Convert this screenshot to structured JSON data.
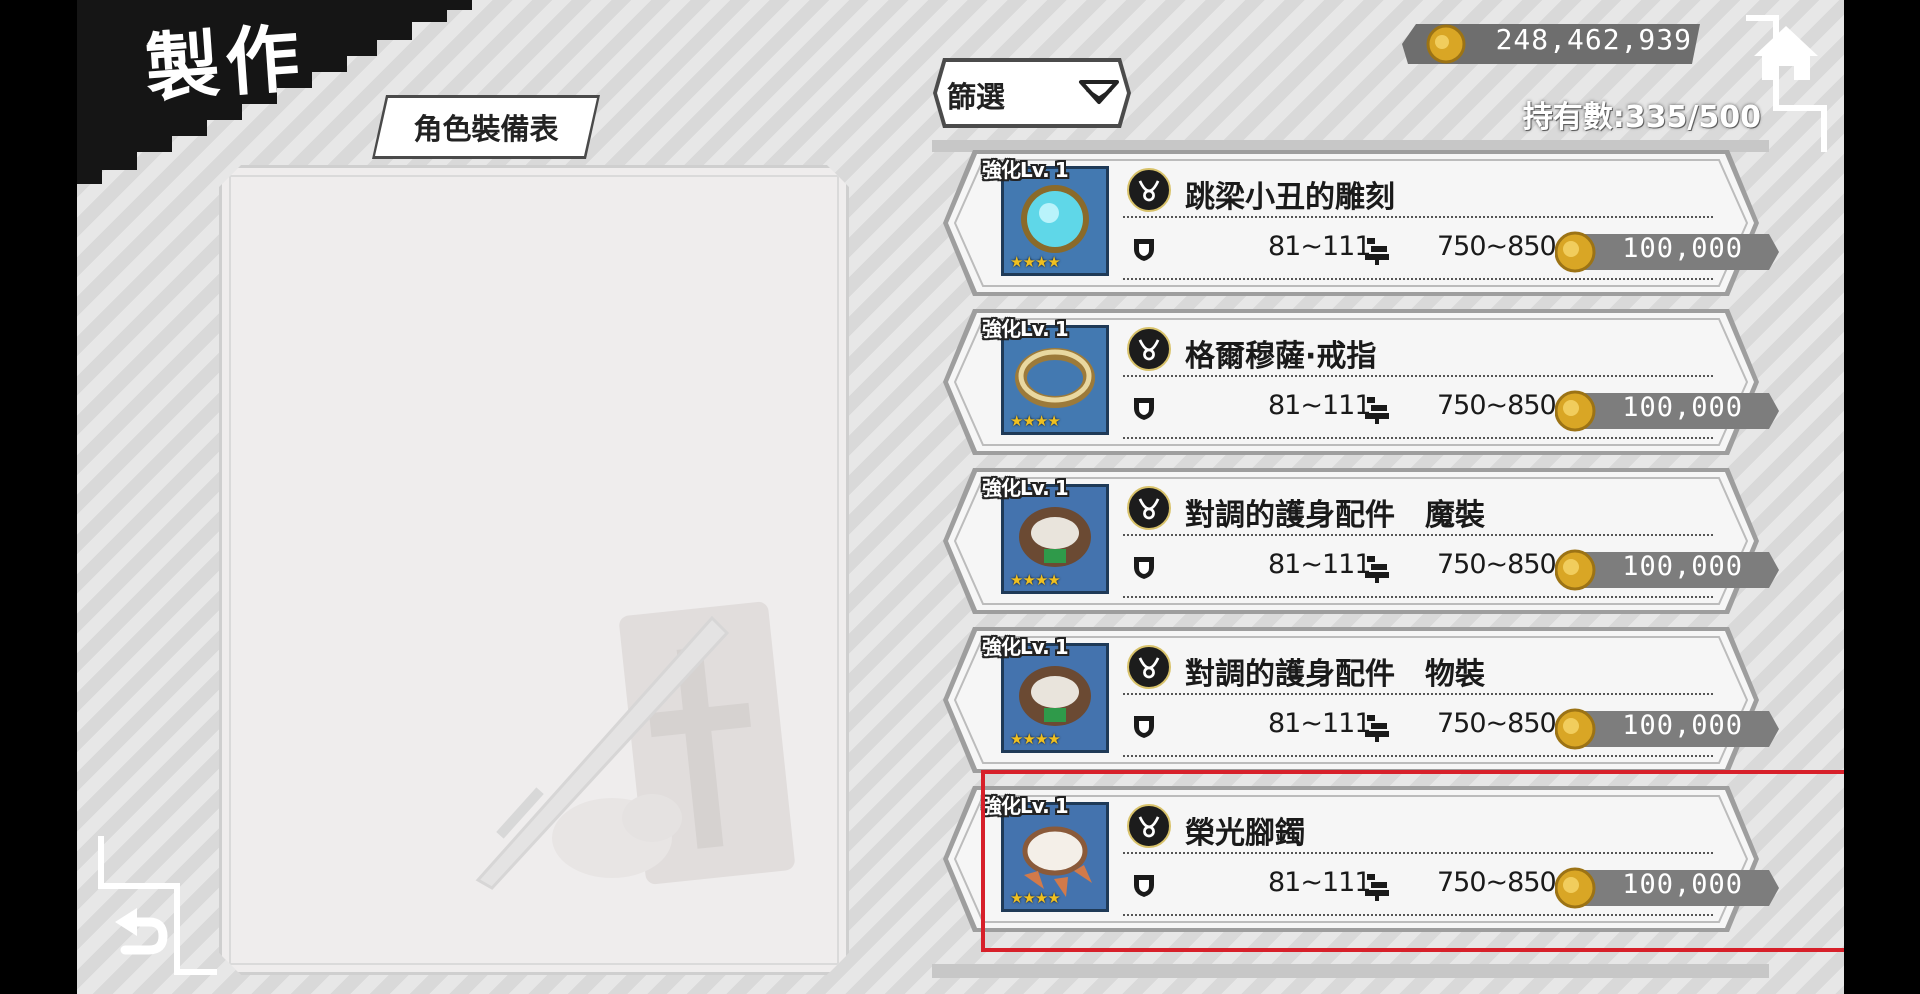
{
  "header": {
    "title": "製作",
    "equipment_tab_label": "角色裝備表",
    "filter_label": "篩選",
    "currency_amount": "248,462,939",
    "held_count_label": "持有數",
    "held_count_value": ":335/500"
  },
  "icons": {
    "home": "home-icon",
    "back": "return-arrow-icon",
    "coin": "gold-coin-icon",
    "filter_dropdown": "chevron-down-icon",
    "accessory_type": "necklace-icon",
    "defense": "shield-icon",
    "weight": "weight-icon"
  },
  "items": [
    {
      "level": "強化Lv. 1",
      "stars": "★★★★",
      "name": "跳梁小丑的雕刻",
      "defense": "81~111",
      "weight": "750~850",
      "price": "100,000",
      "thumb": "blue-gem-brooch"
    },
    {
      "level": "強化Lv. 1",
      "stars": "★★★★",
      "name": "格爾穆薩·戒指",
      "defense": "81~111",
      "weight": "750~850",
      "price": "100,000",
      "thumb": "gold-ring"
    },
    {
      "level": "強化Lv. 1",
      "stars": "★★★★",
      "name": "對調的護身配件　魔裝",
      "defense": "81~111",
      "weight": "750~850",
      "price": "100,000",
      "thumb": "leather-bracelet"
    },
    {
      "level": "強化Lv. 1",
      "stars": "★★★★",
      "name": "對調的護身配件　物裝",
      "defense": "81~111",
      "weight": "750~850",
      "price": "100,000",
      "thumb": "leather-bracelet"
    },
    {
      "level": "強化Lv. 1",
      "stars": "★★★★",
      "name": "榮光腳鐲",
      "defense": "81~111",
      "weight": "750~850",
      "price": "100,000",
      "thumb": "feather-anklet"
    }
  ],
  "colors": {
    "highlight": "#d7202a",
    "price_bar": "#7d7d7d",
    "coin": "#d9a625",
    "thumb_frame": "#1f3a57"
  }
}
